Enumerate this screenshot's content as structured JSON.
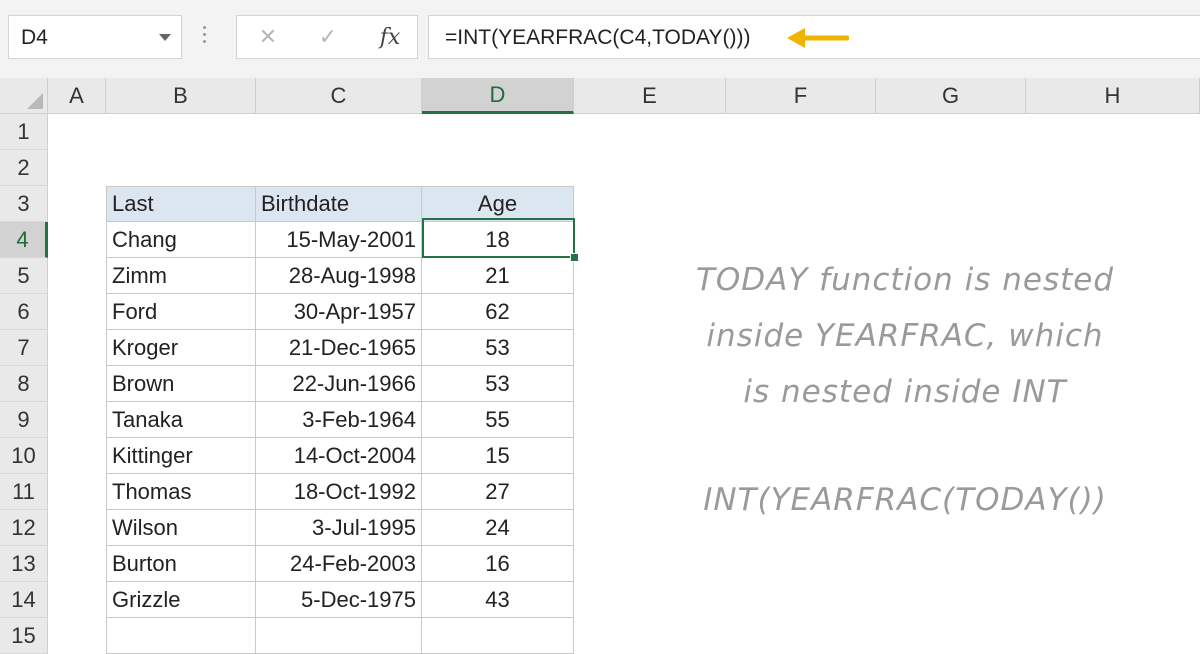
{
  "formula_bar": {
    "name_box": "D4",
    "cancel_icon": "✕",
    "enter_icon": "✓",
    "fx_label": "fx",
    "formula": "=INT(YEARFRAC(C4,TODAY()))"
  },
  "columns": [
    "A",
    "B",
    "C",
    "D",
    "E",
    "F",
    "G",
    "H"
  ],
  "rows": [
    "1",
    "2",
    "3",
    "4",
    "5",
    "6",
    "7",
    "8",
    "9",
    "10",
    "11",
    "12",
    "13",
    "14",
    "15"
  ],
  "selected_cell": "D4",
  "table": {
    "headers": [
      "Last",
      "Birthdate",
      "Age"
    ],
    "rows": [
      [
        "Chang",
        "15-May-2001",
        "18"
      ],
      [
        "Zimm",
        "28-Aug-1998",
        "21"
      ],
      [
        "Ford",
        "30-Apr-1957",
        "62"
      ],
      [
        "Kroger",
        "21-Dec-1965",
        "53"
      ],
      [
        "Brown",
        "22-Jun-1966",
        "53"
      ],
      [
        "Tanaka",
        "3-Feb-1964",
        "55"
      ],
      [
        "Kittinger",
        "14-Oct-2004",
        "15"
      ],
      [
        "Thomas",
        "18-Oct-1992",
        "27"
      ],
      [
        "Wilson",
        "3-Jul-1995",
        "24"
      ],
      [
        "Burton",
        "24-Feb-2003",
        "16"
      ],
      [
        "Grizzle",
        "5-Dec-1975",
        "43"
      ]
    ]
  },
  "notes": {
    "line1": "TODAY function is nested",
    "line2": "inside YEARFRAC, which",
    "line3": "is nested inside INT",
    "line4": "INT(YEARFRAC(TODAY())"
  },
  "colors": {
    "accent_green": "#217346",
    "header_fill": "#dce6f1",
    "arrow": "#f0b400"
  }
}
